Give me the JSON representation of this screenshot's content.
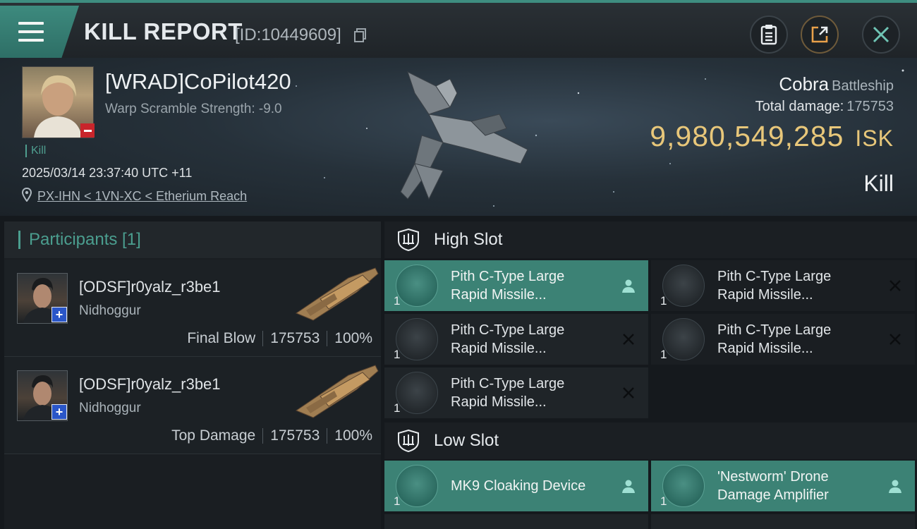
{
  "titlebar": {
    "title": "KILL REPORT",
    "id_label": "[ID:10449609]",
    "icons": [
      "menu-icon",
      "copy-icon",
      "clipboard-icon",
      "share-icon",
      "close-icon"
    ]
  },
  "victim": {
    "name": "[WRAD]CoPilot420",
    "subtitle": "Warp Scramble Strength: -9.0",
    "tag": "Kill",
    "timestamp": "2025/03/14 23:37:40 UTC +11",
    "location": "PX-IHN < 1VN-XC < Etherium Reach",
    "ship_name": "Cobra",
    "ship_class": "Battleship",
    "total_damage_label": "Total damage:",
    "total_damage_value": "175753",
    "isk_value": "9,980,549,285",
    "isk_unit": "ISK",
    "result": "Kill"
  },
  "participants": {
    "header": "Participants [1]",
    "rows": [
      {
        "name": "[ODSF]r0yalz_r3be1",
        "ship": "Nidhoggur",
        "role": "Final Blow",
        "damage": "175753",
        "percent": "100%"
      },
      {
        "name": "[ODSF]r0yalz_r3be1",
        "ship": "Nidhoggur",
        "role": "Top Damage",
        "damage": "175753",
        "percent": "100%"
      }
    ]
  },
  "slots": {
    "high": {
      "title": "High Slot",
      "modules": [
        {
          "qty": "1",
          "line1": "Pith C-Type Large",
          "line2": "Rapid Missile...",
          "status": "fitted"
        },
        {
          "qty": "1",
          "line1": "Pith C-Type Large",
          "line2": "Rapid Missile...",
          "status": "destroyed"
        },
        {
          "qty": "1",
          "line1": "Pith C-Type Large",
          "line2": "Rapid Missile...",
          "status": "destroyed"
        },
        {
          "qty": "1",
          "line1": "Pith C-Type Large",
          "line2": "Rapid Missile...",
          "status": "destroyed"
        },
        {
          "qty": "1",
          "line1": "Pith C-Type Large",
          "line2": "Rapid Missile...",
          "status": "destroyed"
        }
      ]
    },
    "low": {
      "title": "Low Slot",
      "modules": [
        {
          "qty": "1",
          "line1": "MK9 Cloaking Device",
          "line2": "",
          "status": "fitted"
        },
        {
          "qty": "1",
          "line1": "'Nestworm' Drone",
          "line2": "Damage Amplifier",
          "status": "fitted"
        }
      ]
    }
  },
  "colors": {
    "accent_teal": "#3c8275",
    "isk_gold": "#e8c77a",
    "badge_red": "#c8252b",
    "badge_blue": "#2a56c8"
  }
}
